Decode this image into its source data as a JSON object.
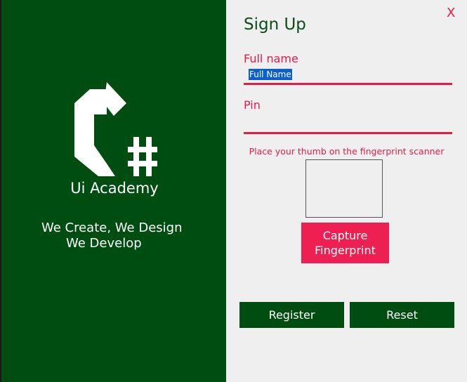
{
  "left_panel": {
    "brand": "Ui Academy",
    "tagline_line1": "We Create, We Design",
    "tagline_line2": "We Develop"
  },
  "form": {
    "title": "Sign Up",
    "close_label": "X",
    "full_name": {
      "label": "Full name",
      "value": "Full Name"
    },
    "pin": {
      "label": "Pin",
      "value": ""
    },
    "scanner_hint": "Place your thumb on the fingerprint scanner",
    "capture_line1": "Capture",
    "capture_line2": "Fingerprint",
    "register_label": "Register",
    "reset_label": "Reset"
  },
  "colors": {
    "panel_green": "#004d12",
    "accent_red": "#e31c49",
    "capture_red": "#ee1f51",
    "background": "#efefef",
    "selection_blue": "#0a5fc9"
  },
  "icons": {
    "logo": "csharp-logo-icon"
  }
}
